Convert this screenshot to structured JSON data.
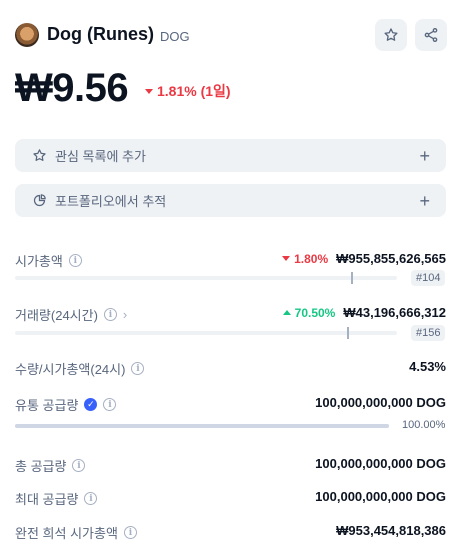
{
  "coin": {
    "name": "Dog (Runes)",
    "symbol": "DOG",
    "price": "₩9.56",
    "change": "1.81% (1일)",
    "change_color": "#ea3943"
  },
  "actions": {
    "watchlist_label": "관심 목록에 추가",
    "portfolio_label": "포트폴리오에서 추적",
    "plus": "+"
  },
  "stats": {
    "market_cap": {
      "label": "시가총액",
      "change": "1.80%",
      "value": "₩955,855,626,565",
      "rank": "#104",
      "level": 0.88
    },
    "volume": {
      "label": "거래량(24시간)",
      "change": "70.50%",
      "value": "₩43,196,666,312",
      "rank": "#156",
      "level": 0.87
    },
    "vol_mcap": {
      "label": "수량/시가총액(24시)",
      "value": "4.53%"
    },
    "circulating": {
      "label": "유통 공급량",
      "value": "100,000,000,000 DOG",
      "percent": "100.00%",
      "level": 1.0
    },
    "total_supply": {
      "label": "총 공급량",
      "value": "100,000,000,000 DOG"
    },
    "max_supply": {
      "label": "최대 공급량",
      "value": "100,000,000,000 DOG"
    },
    "fdv": {
      "label": "완전 희석 시가총액",
      "value": "₩953,454,818,386"
    }
  },
  "icons": {
    "star": "star-icon",
    "share": "share-icon",
    "info": "info-icon",
    "pie": "pie-chart-icon",
    "verified": "verified-check-icon",
    "chevron": "chevron-right-icon"
  },
  "colors": {
    "negative": "#ea3943",
    "positive": "#16c784",
    "verified": "#3861fb"
  }
}
